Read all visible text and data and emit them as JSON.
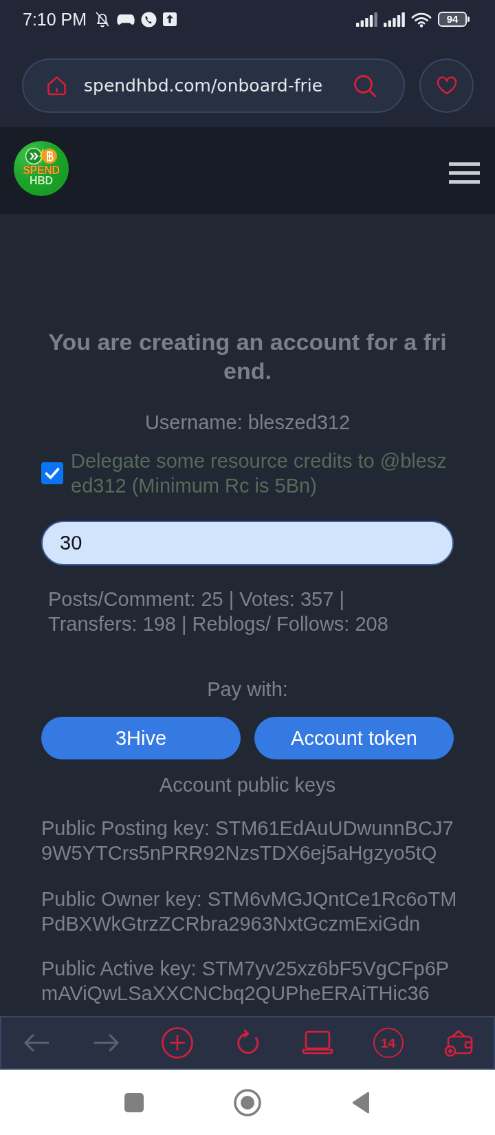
{
  "status_bar": {
    "time": "7:10 PM",
    "battery": "94"
  },
  "browser": {
    "url": "spendhbd.com/onboard-frie"
  },
  "site_header": {
    "logo_text": [
      "SPEND",
      "HBD"
    ]
  },
  "form": {
    "title": "You are creating an account for a friend.",
    "username": "Username: bleszed312",
    "delegate": {
      "checked": true,
      "label": "Delegate some resource credits to @bleszed312 (Minimum Rc is 5Bn)"
    },
    "rc_input": {
      "value": "30"
    },
    "stats": "Posts/Comment: 25 | Votes: 357 | Transfers: 198 | Reblogs/ Follows: 208",
    "pay_with": {
      "label": "Pay with:",
      "buttons": [
        "3Hive",
        "Account token"
      ]
    },
    "keys_heading": "Account public keys",
    "keys": [
      "Public Posting key: STM61EdAuUDwunnBCJ79W5YTCrs5nPRR92NzsTDX6ej5aHgzyo5tQ",
      "Public Owner key: STM6vMGJQntCe1Rc6oTMPdBXWkGtrzZCRbra2963NxtGczmExiGdn",
      "Public Active key: STM7yv25xz6bF5VgCFp6PmAViQwLSaXXCNCbq2QUPheERAiTHic36"
    ]
  },
  "toolbar": {
    "back": {
      "disabled": true
    },
    "forward": {
      "disabled": true
    },
    "tab_count": "14"
  }
}
